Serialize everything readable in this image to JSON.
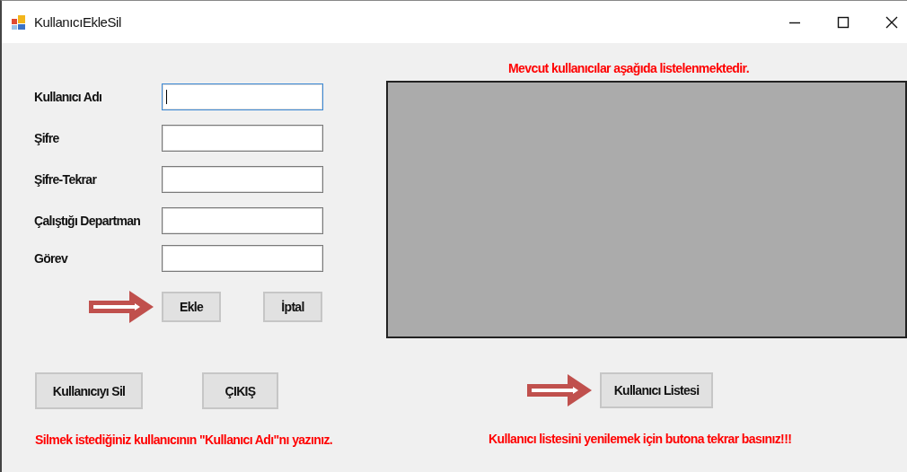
{
  "window": {
    "title": "KullanıcıEkleSil"
  },
  "fields": [
    {
      "label": "Kullanıcı Adı",
      "focused": true
    },
    {
      "label": "Şifre",
      "focused": false
    },
    {
      "label": "Şifre-Tekrar",
      "focused": false
    },
    {
      "label": "Çalıştığı Departman",
      "focused": false
    },
    {
      "label": "Görev",
      "focused": false
    }
  ],
  "form_buttons": [
    "Ekle",
    "İptal"
  ],
  "list_caption": "Mevcut kullanıcılar aşağıda listelenmektedir.",
  "bottom_buttons": [
    "Kullanıcıyı Sil",
    "ÇIKIŞ"
  ],
  "list_button": "Kullanıcı Listesi",
  "delete_hint": "Silmek istediğiniz kullanıcının \"Kullanıcı Adı\"nı yazınız.",
  "refresh_hint": "Kullanıcı listesini yenilemek için butona tekrar basınız!!!"
}
